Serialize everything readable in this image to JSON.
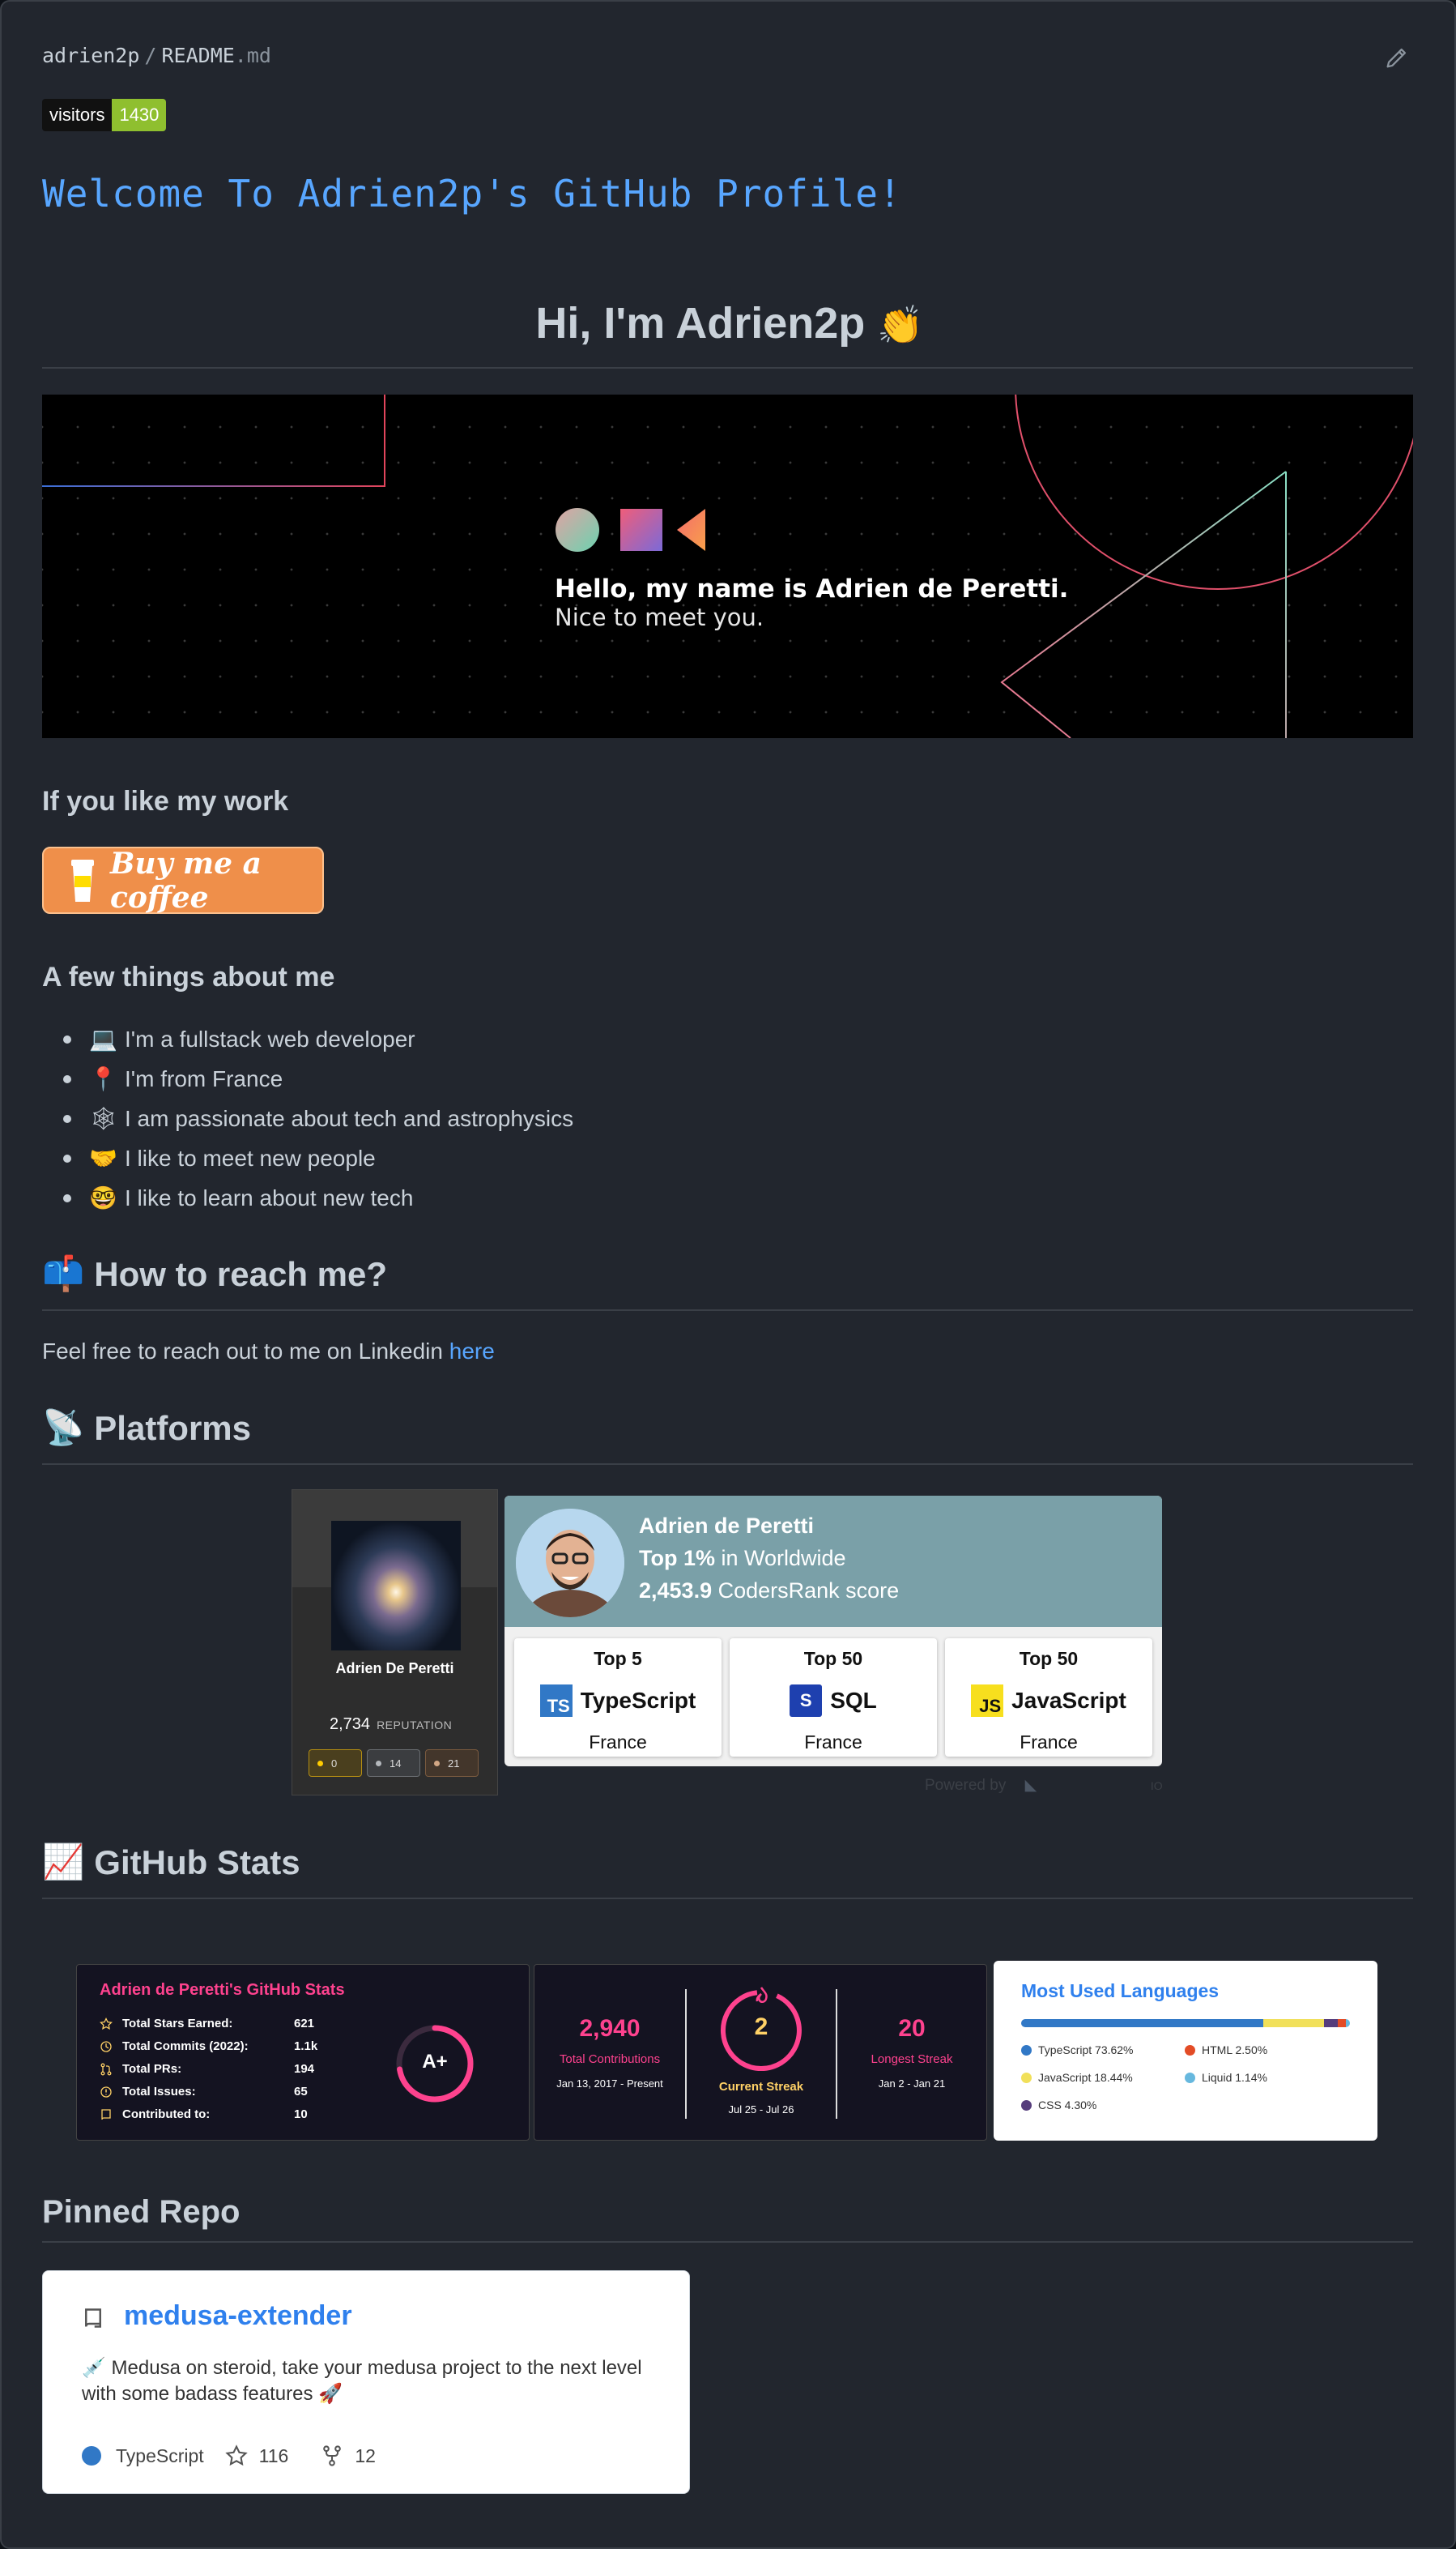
{
  "header": {
    "user": "adrien2p",
    "separator": "/",
    "file_name": "README",
    "file_ext": ".md",
    "edit_icon": "pencil-icon"
  },
  "visitors_badge": {
    "label": "visitors",
    "count": "1430",
    "count_color": "#8fbf2f"
  },
  "welcome_title": "Welcome To Adrien2p's GitHub Profile!",
  "greeting": {
    "text": "Hi, I'm Adrien2p",
    "emoji": "👏"
  },
  "banner": {
    "line1": "Hello, my name is Adrien de Peretti.",
    "line2": "Nice to meet you."
  },
  "support": {
    "heading": "If you like my work",
    "button_label": "Buy me a coffee"
  },
  "about": {
    "heading": "A few things about me",
    "items": [
      {
        "emoji": "💻",
        "text": "I'm a fullstack web developer"
      },
      {
        "emoji": "📍",
        "text": "I'm from France"
      },
      {
        "emoji": "🕸",
        "text": "I am passionate about tech and astrophysics"
      },
      {
        "emoji": "🤝",
        "text": "I like to meet new people"
      },
      {
        "emoji": "🤓",
        "text": "I like to learn about new tech"
      }
    ]
  },
  "reach": {
    "emoji": "📫",
    "heading": "How to reach me?",
    "text": "Feel free to reach out to me on Linkedin ",
    "link_label": "here"
  },
  "platforms": {
    "emoji": "📡",
    "heading": "Platforms",
    "stackoverflow": {
      "name": "Adrien De Peretti",
      "reputation": "2,734",
      "reputation_label": "REPUTATION",
      "badges": [
        {
          "count": "0",
          "color": "#ffcc01",
          "border": "#b58e12"
        },
        {
          "count": "14",
          "color": "#b4b8bc",
          "border": "#6a6e72"
        },
        {
          "count": "21",
          "color": "#d1a684",
          "border": "#7a5a3f"
        }
      ]
    },
    "codersrank": {
      "name": "Adrien de Peretti",
      "rank_bold": "Top 1%",
      "rank_rest": " in Worldwide",
      "score_bold": "2,453.9",
      "score_rest": " CodersRank score",
      "cards": [
        {
          "top": "Top 5",
          "logo_text": "TS",
          "logo_color": "#3178c6",
          "logo_fg": "#ffffff",
          "lang": "TypeScript",
          "country": "France"
        },
        {
          "top": "Top 50",
          "logo_text": "S",
          "logo_color": "#1e40af",
          "logo_fg": "#ffffff",
          "lang": "SQL",
          "country": "France"
        },
        {
          "top": "Top 50",
          "logo_text": "JS",
          "logo_color": "#f7df1e",
          "logo_fg": "#111111",
          "lang": "JavaScript",
          "country": "France"
        }
      ],
      "powered_by": "Powered by",
      "powered_suffix": "IO"
    }
  },
  "github_stats": {
    "emoji": "📈",
    "heading": "GitHub Stats",
    "stats_card": {
      "title": "Adrien de Peretti's GitHub Stats",
      "rows": [
        {
          "icon": "star-icon",
          "label": "Total Stars Earned:",
          "value": "621"
        },
        {
          "icon": "history-icon",
          "label": "Total Commits (2022):",
          "value": "1.1k"
        },
        {
          "icon": "pull-request-icon",
          "label": "Total PRs:",
          "value": "194"
        },
        {
          "icon": "issue-icon",
          "label": "Total Issues:",
          "value": "65"
        },
        {
          "icon": "repo-icon",
          "label": "Contributed to:",
          "value": "10"
        }
      ],
      "grade": "A+"
    },
    "streak_card": {
      "total": {
        "value": "2,940",
        "label": "Total Contributions",
        "range": "Jan 13, 2017 - Present"
      },
      "current": {
        "value": "2",
        "label": "Current Streak",
        "range": "Jul 25 - Jul 26"
      },
      "longest": {
        "value": "20",
        "label": "Longest Streak",
        "range": "Jan 2 - Jan 21"
      }
    },
    "languages_card": {
      "title": "Most Used Languages",
      "languages": [
        {
          "name": "TypeScript",
          "percent": 73.62,
          "label": "TypeScript 73.62%",
          "color": "#3178c6"
        },
        {
          "name": "JavaScript",
          "percent": 18.44,
          "label": "JavaScript 18.44%",
          "color": "#f1e05a"
        },
        {
          "name": "CSS",
          "percent": 4.3,
          "label": "CSS 4.30%",
          "color": "#563d7c"
        },
        {
          "name": "HTML",
          "percent": 2.5,
          "label": "HTML 2.50%",
          "color": "#e34c26"
        },
        {
          "name": "Liquid",
          "percent": 1.14,
          "label": "Liquid 1.14%",
          "color": "#67b8de"
        }
      ]
    }
  },
  "pinned": {
    "heading": "Pinned Repo",
    "repo": {
      "name": "medusa-extender",
      "description_emoji": "💉",
      "description": " Medusa on steroid, take your medusa project to the next level with some badass features 🚀",
      "language": "TypeScript",
      "language_color": "#3178c6",
      "stars": "116",
      "forks": "12"
    }
  }
}
